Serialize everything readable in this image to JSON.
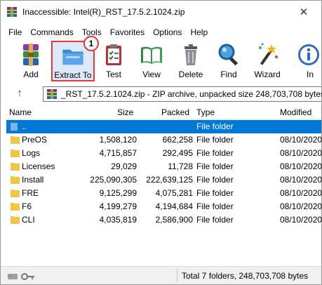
{
  "window": {
    "title": "Inaccessible: Intel(R)_RST_17.5.2.1024.zip",
    "close_label": "✕"
  },
  "menu": [
    "File",
    "Commands",
    "Tools",
    "Favorites",
    "Options",
    "Help"
  ],
  "toolbar": {
    "buttons": [
      {
        "label": "Add",
        "icon": "add-archive-icon"
      },
      {
        "label": "Extract To",
        "icon": "extract-folder-icon"
      },
      {
        "label": "Test",
        "icon": "test-clipboard-icon"
      },
      {
        "label": "View",
        "icon": "view-book-icon"
      },
      {
        "label": "Delete",
        "icon": "delete-trash-icon"
      },
      {
        "label": "Find",
        "icon": "find-magnifier-icon"
      },
      {
        "label": "Wizard",
        "icon": "wizard-wand-icon"
      },
      {
        "label": "In",
        "icon": "info-icon"
      }
    ],
    "callout_number": "1"
  },
  "address": {
    "text": "_RST_17.5.2.1024.zip - ZIP archive, unpacked size 248,703,708 bytes"
  },
  "columns": {
    "name": "Name",
    "size": "Size",
    "packed": "Packed",
    "type": "Type",
    "modified": "Modified"
  },
  "rows": [
    {
      "name": "..",
      "size": "",
      "packed": "",
      "type": "File folder",
      "modified": ""
    },
    {
      "name": "PreOS",
      "size": "1,508,120",
      "packed": "662,258",
      "type": "File folder",
      "modified": "08/10/2020"
    },
    {
      "name": "Logs",
      "size": "4,715,857",
      "packed": "292,495",
      "type": "File folder",
      "modified": "08/10/2020"
    },
    {
      "name": "Licenses",
      "size": "29,029",
      "packed": "11,728",
      "type": "File folder",
      "modified": "08/10/2020"
    },
    {
      "name": "Install",
      "size": "225,090,305",
      "packed": "222,639,125",
      "type": "File folder",
      "modified": "08/10/2020"
    },
    {
      "name": "FRE",
      "size": "9,125,299",
      "packed": "4,075,281",
      "type": "File folder",
      "modified": "08/10/2020"
    },
    {
      "name": "F6",
      "size": "4,199,279",
      "packed": "4,194,684",
      "type": "File folder",
      "modified": "08/10/2020"
    },
    {
      "name": "CLI",
      "size": "4,035,819",
      "packed": "2,586,900",
      "type": "File folder",
      "modified": "08/10/2020"
    }
  ],
  "status": {
    "text": "Total 7 folders, 248,703,708 bytes"
  },
  "colors": {
    "selection": "#0078d7",
    "callout": "#e53935",
    "folder": "#f4c542"
  }
}
